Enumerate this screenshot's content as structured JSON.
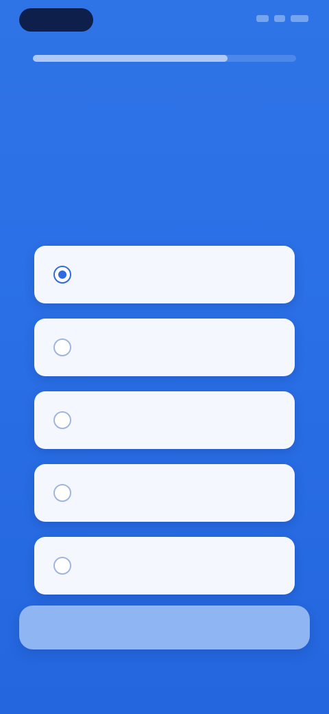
{
  "header": {
    "progress": 0.74
  },
  "question": {
    "title": "",
    "subtitle": ""
  },
  "options": [
    {
      "label": "",
      "selected": true
    },
    {
      "label": "",
      "selected": false
    },
    {
      "label": "",
      "selected": false
    },
    {
      "label": "",
      "selected": false
    },
    {
      "label": "",
      "selected": false
    }
  ],
  "footer": {
    "continue_label": ""
  },
  "colors": {
    "background": "#2f74e6",
    "option_background": "#f4f7fd",
    "button_background": "#8fb5f3",
    "accent": "#2f6be0"
  }
}
